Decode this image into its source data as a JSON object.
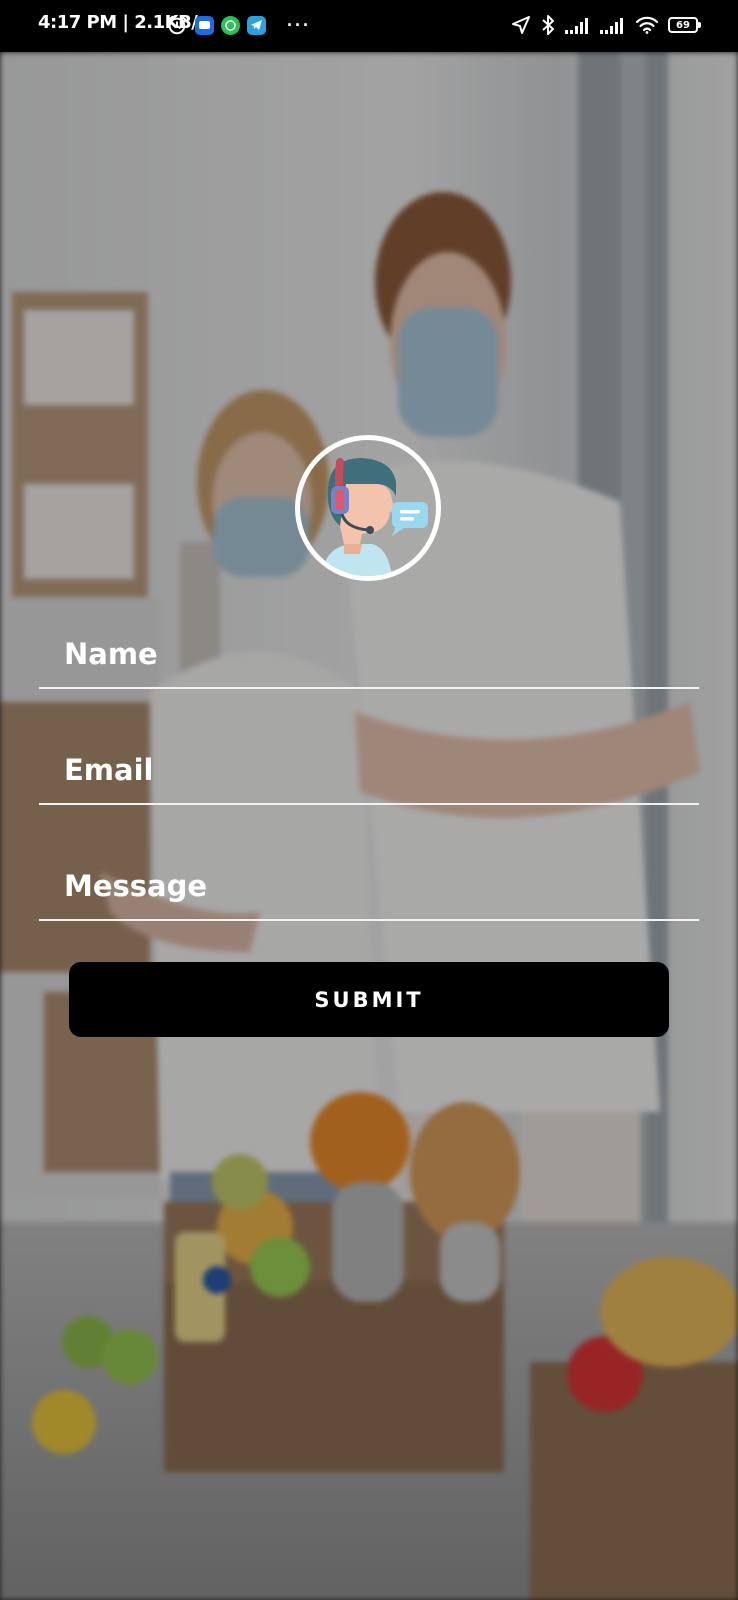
{
  "status_bar": {
    "time": "4:17 PM | 2.1KB/s",
    "battery": "69",
    "more": "···",
    "icons_left": [
      "alarm-icon",
      "messages-app-icon",
      "whatsapp-icon",
      "telegram-icon"
    ],
    "icons_right": [
      "location-icon",
      "bluetooth-icon",
      "signal-icon",
      "signal-icon",
      "wifi-icon",
      "battery-icon"
    ]
  },
  "background": {
    "description_icons": [
      "support-agent-icon"
    ]
  },
  "form": {
    "name_placeholder": "Name",
    "email_placeholder": "Email",
    "message_placeholder": "Message",
    "submit_label": "SUBMIT"
  },
  "colors": {
    "button_bg": "#000000",
    "button_text": "#ffffff",
    "field_text": "#ffffff",
    "underline": "#f2f2f2"
  }
}
